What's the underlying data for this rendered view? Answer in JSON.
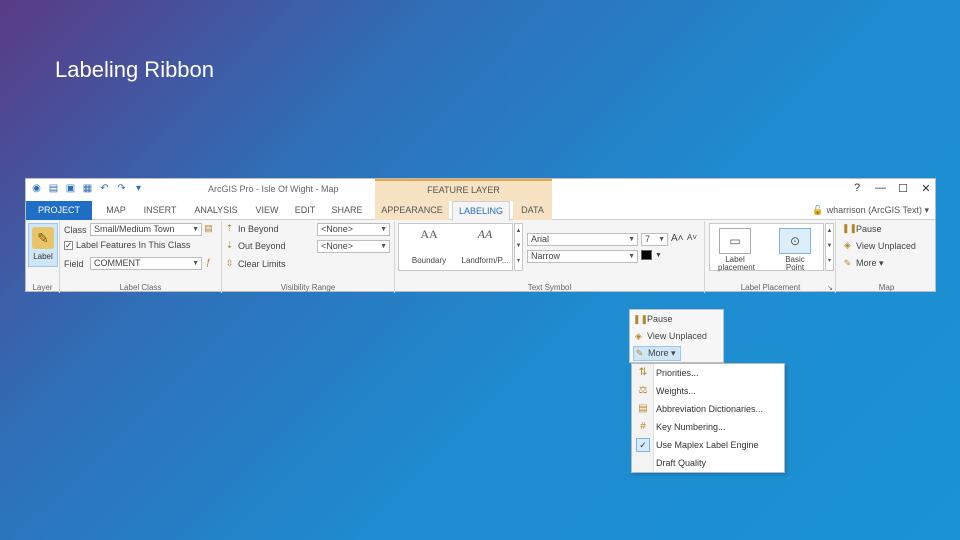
{
  "slide": {
    "title": "Labeling Ribbon"
  },
  "titlebar": {
    "app_title": "ArcGIS Pro - Isle Of Wight - Map",
    "context_header": "FEATURE LAYER",
    "controls": {
      "help": "?",
      "minimize": "—",
      "maximize": "☐",
      "close": "✕"
    }
  },
  "tabs": [
    "PROJECT",
    "MAP",
    "INSERT",
    "ANALYSIS",
    "VIEW",
    "EDIT",
    "SHARE",
    "APPEARANCE",
    "LABELING",
    "DATA"
  ],
  "user": {
    "name": "wharrison (ArcGIS Text) ▾"
  },
  "layer_group": {
    "label_button": "Label",
    "group_label": "Layer"
  },
  "label_class_group": {
    "class_label": "Class",
    "class_value": "Small/Medium Town",
    "checkbox_label": "Label Features In This Class",
    "field_label": "Field",
    "field_value": "COMMENT",
    "group_label": "Label Class"
  },
  "visibility_group": {
    "in_beyond": "In Beyond",
    "out_beyond": "Out Beyond",
    "clear_limits": "Clear Limits",
    "in_value": "<None>",
    "out_value": "<None>",
    "group_label": "Visibility Range"
  },
  "text_symbol_group": {
    "gallery": [
      {
        "sample": "AA",
        "name": "Boundary"
      },
      {
        "sample": "AA",
        "name": "Landform/P..."
      }
    ],
    "font": "Arial",
    "style": "Narrow",
    "size": "7",
    "group_label": "Text Symbol"
  },
  "placement_group": {
    "items": [
      {
        "name": "Label placement"
      },
      {
        "name": "Basic Point"
      }
    ],
    "group_label": "Label Placement"
  },
  "map_group": {
    "pause": "Pause",
    "view_unplaced": "View Unplaced",
    "more": "More ▾",
    "group_label": "Map"
  },
  "popup": {
    "pause": "Pause",
    "view_unplaced": "View Unplaced",
    "more": "More ▾"
  },
  "more_menu": [
    {
      "label": "Priorities...",
      "checked": false
    },
    {
      "label": "Weights...",
      "checked": false
    },
    {
      "label": "Abbreviation Dictionaries...",
      "checked": false
    },
    {
      "label": "Key Numbering...",
      "checked": false
    },
    {
      "label": "Use Maplex Label Engine",
      "checked": true
    },
    {
      "label": "Draft Quality",
      "checked": false
    }
  ]
}
